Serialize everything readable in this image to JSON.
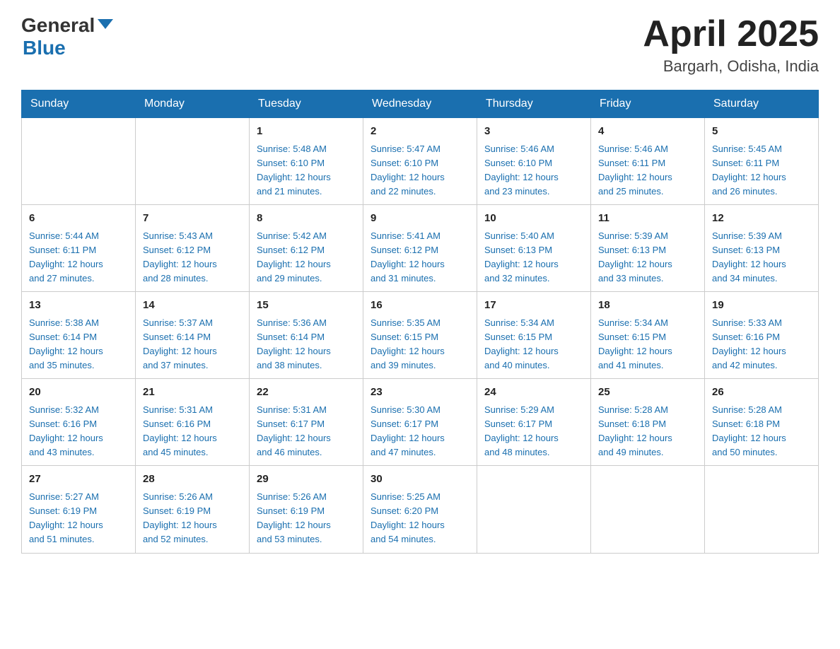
{
  "header": {
    "logo": {
      "general": "General",
      "blue": "Blue"
    },
    "title": "April 2025",
    "subtitle": "Bargarh, Odisha, India"
  },
  "weekdays": [
    "Sunday",
    "Monday",
    "Tuesday",
    "Wednesday",
    "Thursday",
    "Friday",
    "Saturday"
  ],
  "weeks": [
    [
      {
        "day": "",
        "info": ""
      },
      {
        "day": "",
        "info": ""
      },
      {
        "day": "1",
        "info": "Sunrise: 5:48 AM\nSunset: 6:10 PM\nDaylight: 12 hours\nand 21 minutes."
      },
      {
        "day": "2",
        "info": "Sunrise: 5:47 AM\nSunset: 6:10 PM\nDaylight: 12 hours\nand 22 minutes."
      },
      {
        "day": "3",
        "info": "Sunrise: 5:46 AM\nSunset: 6:10 PM\nDaylight: 12 hours\nand 23 minutes."
      },
      {
        "day": "4",
        "info": "Sunrise: 5:46 AM\nSunset: 6:11 PM\nDaylight: 12 hours\nand 25 minutes."
      },
      {
        "day": "5",
        "info": "Sunrise: 5:45 AM\nSunset: 6:11 PM\nDaylight: 12 hours\nand 26 minutes."
      }
    ],
    [
      {
        "day": "6",
        "info": "Sunrise: 5:44 AM\nSunset: 6:11 PM\nDaylight: 12 hours\nand 27 minutes."
      },
      {
        "day": "7",
        "info": "Sunrise: 5:43 AM\nSunset: 6:12 PM\nDaylight: 12 hours\nand 28 minutes."
      },
      {
        "day": "8",
        "info": "Sunrise: 5:42 AM\nSunset: 6:12 PM\nDaylight: 12 hours\nand 29 minutes."
      },
      {
        "day": "9",
        "info": "Sunrise: 5:41 AM\nSunset: 6:12 PM\nDaylight: 12 hours\nand 31 minutes."
      },
      {
        "day": "10",
        "info": "Sunrise: 5:40 AM\nSunset: 6:13 PM\nDaylight: 12 hours\nand 32 minutes."
      },
      {
        "day": "11",
        "info": "Sunrise: 5:39 AM\nSunset: 6:13 PM\nDaylight: 12 hours\nand 33 minutes."
      },
      {
        "day": "12",
        "info": "Sunrise: 5:39 AM\nSunset: 6:13 PM\nDaylight: 12 hours\nand 34 minutes."
      }
    ],
    [
      {
        "day": "13",
        "info": "Sunrise: 5:38 AM\nSunset: 6:14 PM\nDaylight: 12 hours\nand 35 minutes."
      },
      {
        "day": "14",
        "info": "Sunrise: 5:37 AM\nSunset: 6:14 PM\nDaylight: 12 hours\nand 37 minutes."
      },
      {
        "day": "15",
        "info": "Sunrise: 5:36 AM\nSunset: 6:14 PM\nDaylight: 12 hours\nand 38 minutes."
      },
      {
        "day": "16",
        "info": "Sunrise: 5:35 AM\nSunset: 6:15 PM\nDaylight: 12 hours\nand 39 minutes."
      },
      {
        "day": "17",
        "info": "Sunrise: 5:34 AM\nSunset: 6:15 PM\nDaylight: 12 hours\nand 40 minutes."
      },
      {
        "day": "18",
        "info": "Sunrise: 5:34 AM\nSunset: 6:15 PM\nDaylight: 12 hours\nand 41 minutes."
      },
      {
        "day": "19",
        "info": "Sunrise: 5:33 AM\nSunset: 6:16 PM\nDaylight: 12 hours\nand 42 minutes."
      }
    ],
    [
      {
        "day": "20",
        "info": "Sunrise: 5:32 AM\nSunset: 6:16 PM\nDaylight: 12 hours\nand 43 minutes."
      },
      {
        "day": "21",
        "info": "Sunrise: 5:31 AM\nSunset: 6:16 PM\nDaylight: 12 hours\nand 45 minutes."
      },
      {
        "day": "22",
        "info": "Sunrise: 5:31 AM\nSunset: 6:17 PM\nDaylight: 12 hours\nand 46 minutes."
      },
      {
        "day": "23",
        "info": "Sunrise: 5:30 AM\nSunset: 6:17 PM\nDaylight: 12 hours\nand 47 minutes."
      },
      {
        "day": "24",
        "info": "Sunrise: 5:29 AM\nSunset: 6:17 PM\nDaylight: 12 hours\nand 48 minutes."
      },
      {
        "day": "25",
        "info": "Sunrise: 5:28 AM\nSunset: 6:18 PM\nDaylight: 12 hours\nand 49 minutes."
      },
      {
        "day": "26",
        "info": "Sunrise: 5:28 AM\nSunset: 6:18 PM\nDaylight: 12 hours\nand 50 minutes."
      }
    ],
    [
      {
        "day": "27",
        "info": "Sunrise: 5:27 AM\nSunset: 6:19 PM\nDaylight: 12 hours\nand 51 minutes."
      },
      {
        "day": "28",
        "info": "Sunrise: 5:26 AM\nSunset: 6:19 PM\nDaylight: 12 hours\nand 52 minutes."
      },
      {
        "day": "29",
        "info": "Sunrise: 5:26 AM\nSunset: 6:19 PM\nDaylight: 12 hours\nand 53 minutes."
      },
      {
        "day": "30",
        "info": "Sunrise: 5:25 AM\nSunset: 6:20 PM\nDaylight: 12 hours\nand 54 minutes."
      },
      {
        "day": "",
        "info": ""
      },
      {
        "day": "",
        "info": ""
      },
      {
        "day": "",
        "info": ""
      }
    ]
  ]
}
